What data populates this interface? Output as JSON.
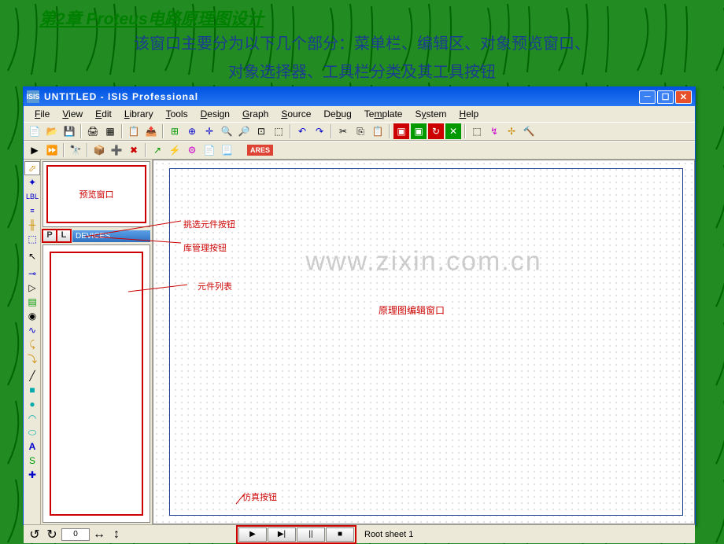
{
  "slide": {
    "title": "第2章  Proteus电路原理图设计",
    "desc1": "该窗口主要分为以下几个部分：菜单栏、编辑区、对象预览窗口、",
    "desc2": "对象选择器、工具栏分类及其工具按钮"
  },
  "window": {
    "title": "UNTITLED  -  ISIS Professional",
    "app_icon": "ISIS"
  },
  "menu": [
    "File",
    "View",
    "Edit",
    "Library",
    "Tools",
    "Design",
    "Graph",
    "Source",
    "Debug",
    "Template",
    "System",
    "Help"
  ],
  "toolbar1_icons": [
    "new",
    "open",
    "save",
    "print",
    "region",
    "sep",
    "paste",
    "cut",
    "sep",
    "grid",
    "origin",
    "crosshair",
    "zoom-in",
    "zoom-out",
    "zoom-all",
    "zoom-area",
    "sep",
    "undo",
    "redo",
    "sep",
    "cut2",
    "copy",
    "paste2",
    "sep",
    "block-copy",
    "block-move",
    "block-rotate",
    "block-delete",
    "sep",
    "pick",
    "wire",
    "text",
    "script"
  ],
  "toolbar2_icons": [
    "realtime",
    "sep",
    "search",
    "sep",
    "package",
    "add-pkg",
    "del-pkg",
    "sep",
    "decompose",
    "make-device",
    "sep",
    "script1",
    "script2"
  ],
  "ares_label": "ARES",
  "left_tools": [
    "select",
    "component",
    "junction",
    "label",
    "text-script",
    "bus",
    "subcircuit",
    "sep",
    "arrow",
    "sep",
    "terminal",
    "device-pin",
    "graph",
    "tape",
    "generator",
    "probe-v",
    "probe-i",
    "sep",
    "line",
    "box",
    "circle",
    "arc",
    "path",
    "text",
    "symbol",
    "plus"
  ],
  "pl": {
    "p": "P",
    "l": "L",
    "devices": "DEVICES"
  },
  "annotations": {
    "preview": "预览窗口",
    "pick_btn": "挑选元件按钮",
    "lib_btn": "库管理按钮",
    "comp_list": "元件列表",
    "edit_area": "原理图编辑窗口",
    "sim_btn": "仿真按钮"
  },
  "watermark": "www.zixin.com.cn",
  "bottom": {
    "step_value": "0",
    "status": "Root sheet 1"
  },
  "sim_icons": [
    "play",
    "step",
    "pause",
    "stop"
  ]
}
